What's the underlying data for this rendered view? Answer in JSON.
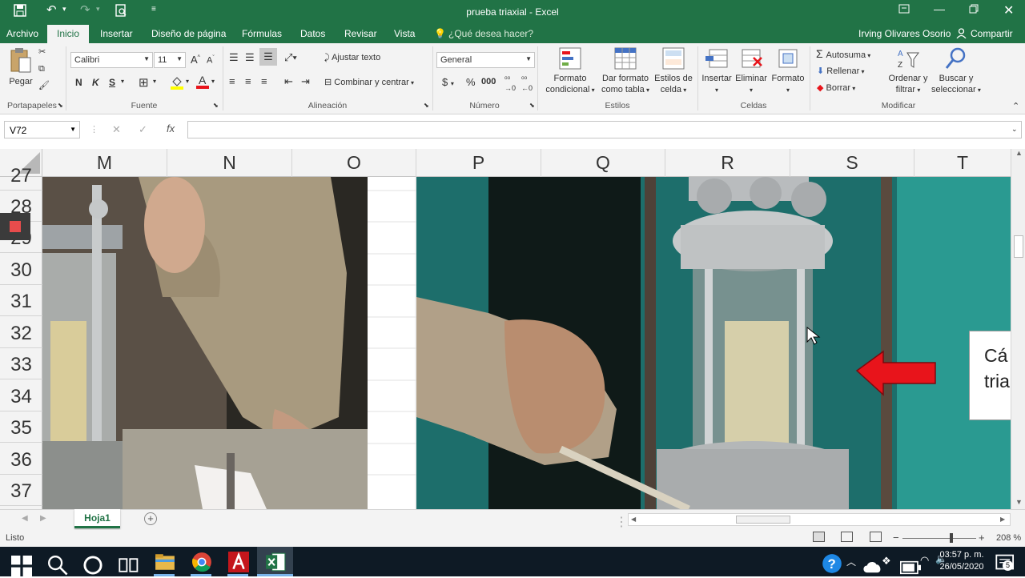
{
  "window": {
    "title": "prueba triaxial - Excel"
  },
  "tabs": [
    "Archivo",
    "Inicio",
    "Insertar",
    "Diseño de página",
    "Fórmulas",
    "Datos",
    "Revisar",
    "Vista"
  ],
  "tell_me": "¿Qué desea hacer?",
  "user": "Irving Olivares Osorio",
  "share": "Compartir",
  "ribbon": {
    "pegar": "Pegar",
    "font_name": "Calibri",
    "font_size": "11",
    "bold": "N",
    "italic": "K",
    "underline": "S",
    "ajustar": "Ajustar texto",
    "combinar": "Combinar y centrar",
    "number_format": "General",
    "formato_cond_1": "Formato",
    "formato_cond_2": "condicional",
    "dar_formato_1": "Dar formato",
    "dar_formato_2": "como tabla",
    "estilos_celda_1": "Estilos de",
    "estilos_celda_2": "celda",
    "insertar": "Insertar",
    "eliminar": "Eliminar",
    "formato": "Formato",
    "autosuma": "Autosuma",
    "rellenar": "Rellenar",
    "borrar": "Borrar",
    "ordenar_1": "Ordenar y",
    "ordenar_2": "filtrar",
    "buscar_1": "Buscar y",
    "buscar_2": "seleccionar",
    "groups": {
      "portapapeles": "Portapapeles",
      "fuente": "Fuente",
      "alineacion": "Alineación",
      "numero": "Número",
      "estilos": "Estilos",
      "celdas": "Celdas",
      "modificar": "Modificar"
    }
  },
  "name_box": "V72",
  "fx": "fx",
  "columns": [
    "M",
    "N",
    "O",
    "P",
    "Q",
    "R",
    "S",
    "T"
  ],
  "rows": [
    "27",
    "28",
    "29",
    "30",
    "31",
    "32",
    "33",
    "34",
    "35",
    "36",
    "37"
  ],
  "callout_text": [
    "Cá",
    "tria"
  ],
  "sheet_tab": "Hoja1",
  "status": "Listo",
  "zoom": "208 %",
  "clock": {
    "time": "03:57 p. m.",
    "date": "26/05/2020"
  },
  "notifications": "5",
  "colors": {
    "excel_green": "#217346",
    "arrow_red": "#e8141b",
    "taskbar": "#0e1a25"
  }
}
